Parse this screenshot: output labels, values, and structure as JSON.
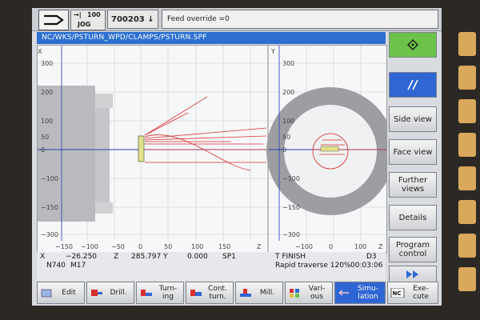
{
  "header": {
    "mode_label": "JOG",
    "feed_pct": "100",
    "program_number": "700203 ↓",
    "message": "Feed override =0"
  },
  "path": "NC/WKS/PSTURN_WPD/CLAMPS/PSTURN.SPF",
  "plot": {
    "left_yticks": [
      "300",
      "200",
      "150",
      "100",
      "50",
      "0",
      "−50",
      "−100",
      "−150",
      "−200",
      "−300"
    ],
    "left_xticks": [
      "−150",
      "−100",
      "−50",
      "0",
      "50",
      "100",
      "150"
    ],
    "left_x_axis": "Z",
    "left_y_axis": "X",
    "right_yticks": [
      "300",
      "200",
      "150",
      "100",
      "50",
      "0",
      "−50",
      "−100",
      "−150",
      "−200",
      "−300"
    ],
    "right_xticks": [
      "−100",
      "0",
      "100"
    ],
    "right_x_axis": "Z",
    "right_y_axis": "Y",
    "line_color": "#d93030",
    "axis_color": "#2a3db8"
  },
  "status": {
    "x_label": "X",
    "x_value": "−26.250",
    "z_label": "Z",
    "z_value": "285.797",
    "y_label": "Y",
    "y_value": "0.000",
    "spindle": "SP1",
    "n_block": "N740",
    "m_code": "M17",
    "cycle": "T FINISH",
    "d_value": "D3",
    "rapid": "Rapid traverse 120%",
    "time": "00:03:06"
  },
  "vertical_softkeys": [
    {
      "label": "",
      "icon": "diamond-icon",
      "style": "green"
    },
    {
      "label": "",
      "icon": "double-slash-icon",
      "style": "blue"
    },
    {
      "label": "Side view",
      "style": "normal"
    },
    {
      "label": "Face view",
      "style": "normal"
    },
    {
      "label": "Further views",
      "style": "normal"
    },
    {
      "label": "Details",
      "style": "normal"
    },
    {
      "label": "Program control",
      "style": "normal"
    },
    {
      "label": "",
      "icon": "fast-forward-icon",
      "style": "blank"
    }
  ],
  "horizontal_softkeys": [
    {
      "label": "Edit"
    },
    {
      "label": "Drill."
    },
    {
      "label": "Turn- ing"
    },
    {
      "label": "Cont. turn."
    },
    {
      "label": "Mill."
    },
    {
      "label": "Vari- ous"
    },
    {
      "label": "Simu- lation"
    },
    {
      "label": "Exe- cute",
      "icon_text": "NC"
    }
  ]
}
